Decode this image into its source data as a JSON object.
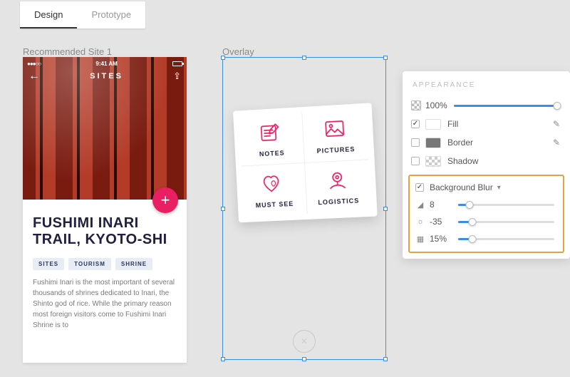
{
  "tabs": {
    "design": "Design",
    "prototype": "Prototype",
    "active": "design"
  },
  "artboard1_label": "Recommended Site 1",
  "artboard2_label": "Overlay",
  "phone": {
    "status_time": "9:41 AM",
    "nav_title": "SITES",
    "title": "FUSHIMI INARI TRAIL, KYOTO-SHI",
    "chips": [
      "SITES",
      "TOURISM",
      "SHRINE"
    ],
    "desc": "Fushimi Inari is the most important of several thousands of shrines dedicated to Inari, the Shinto god of rice. While the primary reason most foreign visitors come to Fushimi Inari Shrine is to"
  },
  "overlay_cells": [
    {
      "label": "NOTES",
      "icon": "notes-icon"
    },
    {
      "label": "PICTURES",
      "icon": "pictures-icon"
    },
    {
      "label": "MUST SEE",
      "icon": "heart-icon"
    },
    {
      "label": "LOGISTICS",
      "icon": "map-pin-icon"
    }
  ],
  "panel": {
    "title": "APPEARANCE",
    "opacity": {
      "value": "100%",
      "fill_pct": 100
    },
    "fill": {
      "checked": true,
      "color": "#ffffff",
      "label": "Fill"
    },
    "border": {
      "checked": false,
      "color": "#777777",
      "label": "Border"
    },
    "shadow": {
      "checked": false,
      "label": "Shadow"
    },
    "background_blur": {
      "checked": true,
      "label": "Background Blur",
      "blur_amount": {
        "value": "8",
        "fill_pct": 12
      },
      "brightness": {
        "value": "-35",
        "fill_pct": 15
      },
      "noise_opacity": {
        "value": "15%",
        "fill_pct": 15
      }
    }
  }
}
